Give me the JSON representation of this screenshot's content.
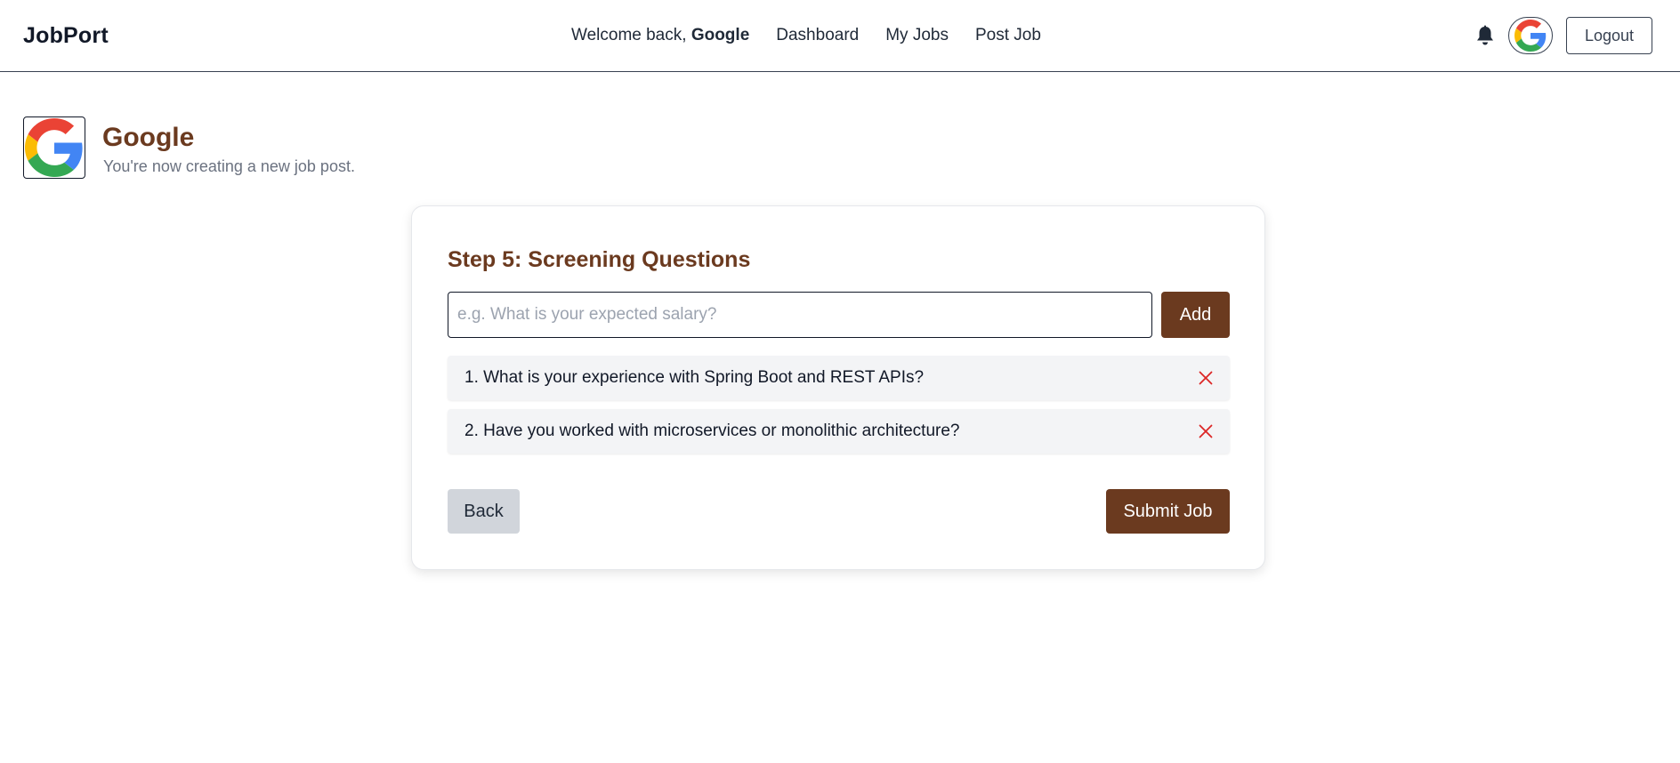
{
  "header": {
    "brand": "JobPort",
    "welcome_prefix": "Welcome back, ",
    "welcome_name": "Google",
    "nav": [
      {
        "label": "Dashboard"
      },
      {
        "label": "My Jobs"
      },
      {
        "label": "Post Job"
      }
    ],
    "icons": {
      "notifications": "bell-icon",
      "avatar": "google-logo"
    },
    "logout_label": "Logout"
  },
  "company": {
    "name": "Google",
    "subtitle": "You're now creating a new job post.",
    "logo": "google-logo"
  },
  "form": {
    "step_title": "Step 5: Screening Questions",
    "input_placeholder": "e.g. What is your expected salary?",
    "input_value": "",
    "add_label": "Add",
    "questions": [
      {
        "text": "1. What is your experience with Spring Boot and REST APIs?",
        "remove_icon": "close-icon"
      },
      {
        "text": "2. Have you worked with microservices or monolithic architecture?",
        "remove_icon": "close-icon"
      }
    ],
    "back_label": "Back",
    "submit_label": "Submit Job"
  },
  "colors": {
    "accent": "#6b3a1f",
    "remove": "#dc2626",
    "secondary_button": "#d1d5db",
    "question_bg": "#f3f4f6"
  }
}
